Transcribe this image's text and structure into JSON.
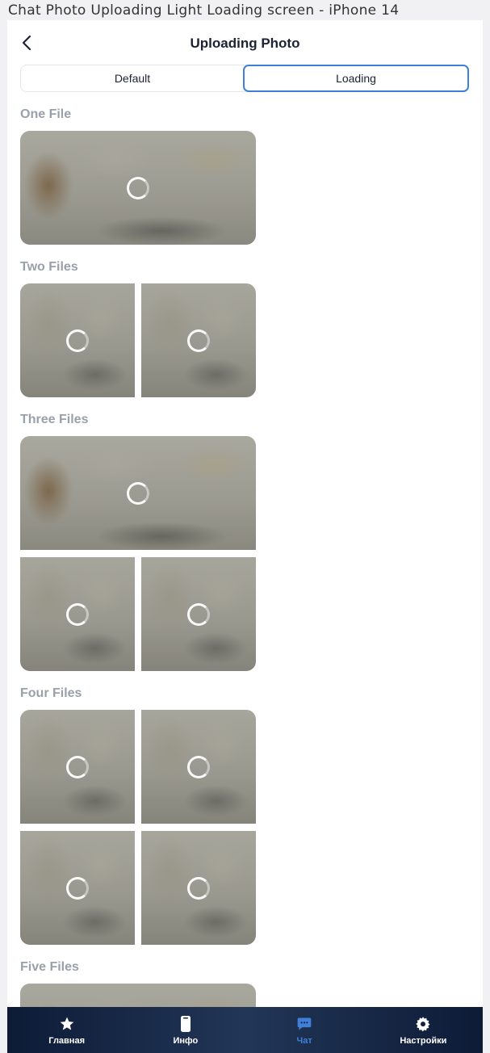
{
  "caption": "Chat Photo Uploading Light Loading screen - iPhone 14",
  "header": {
    "title": "Uploading Photo",
    "back_icon": "chevron-left-icon"
  },
  "segmented": {
    "options": [
      "Default",
      "Loading"
    ],
    "selected": "Loading"
  },
  "sections": {
    "one": "One File",
    "two": "Two Files",
    "three": "Three Files",
    "four": "Four Files",
    "five": "Five Files"
  },
  "tabbar": {
    "items": [
      {
        "label": "Главная",
        "icon": "star-icon"
      },
      {
        "label": "Инфо",
        "icon": "phone-icon"
      },
      {
        "label": "Чат",
        "icon": "chat-icon"
      },
      {
        "label": "Настройки",
        "icon": "gear-icon"
      }
    ],
    "active": "Чат"
  },
  "colors": {
    "accent": "#3f7fd8",
    "tabbar_bg": "#13223f",
    "section_label": "#9aa0aa"
  }
}
